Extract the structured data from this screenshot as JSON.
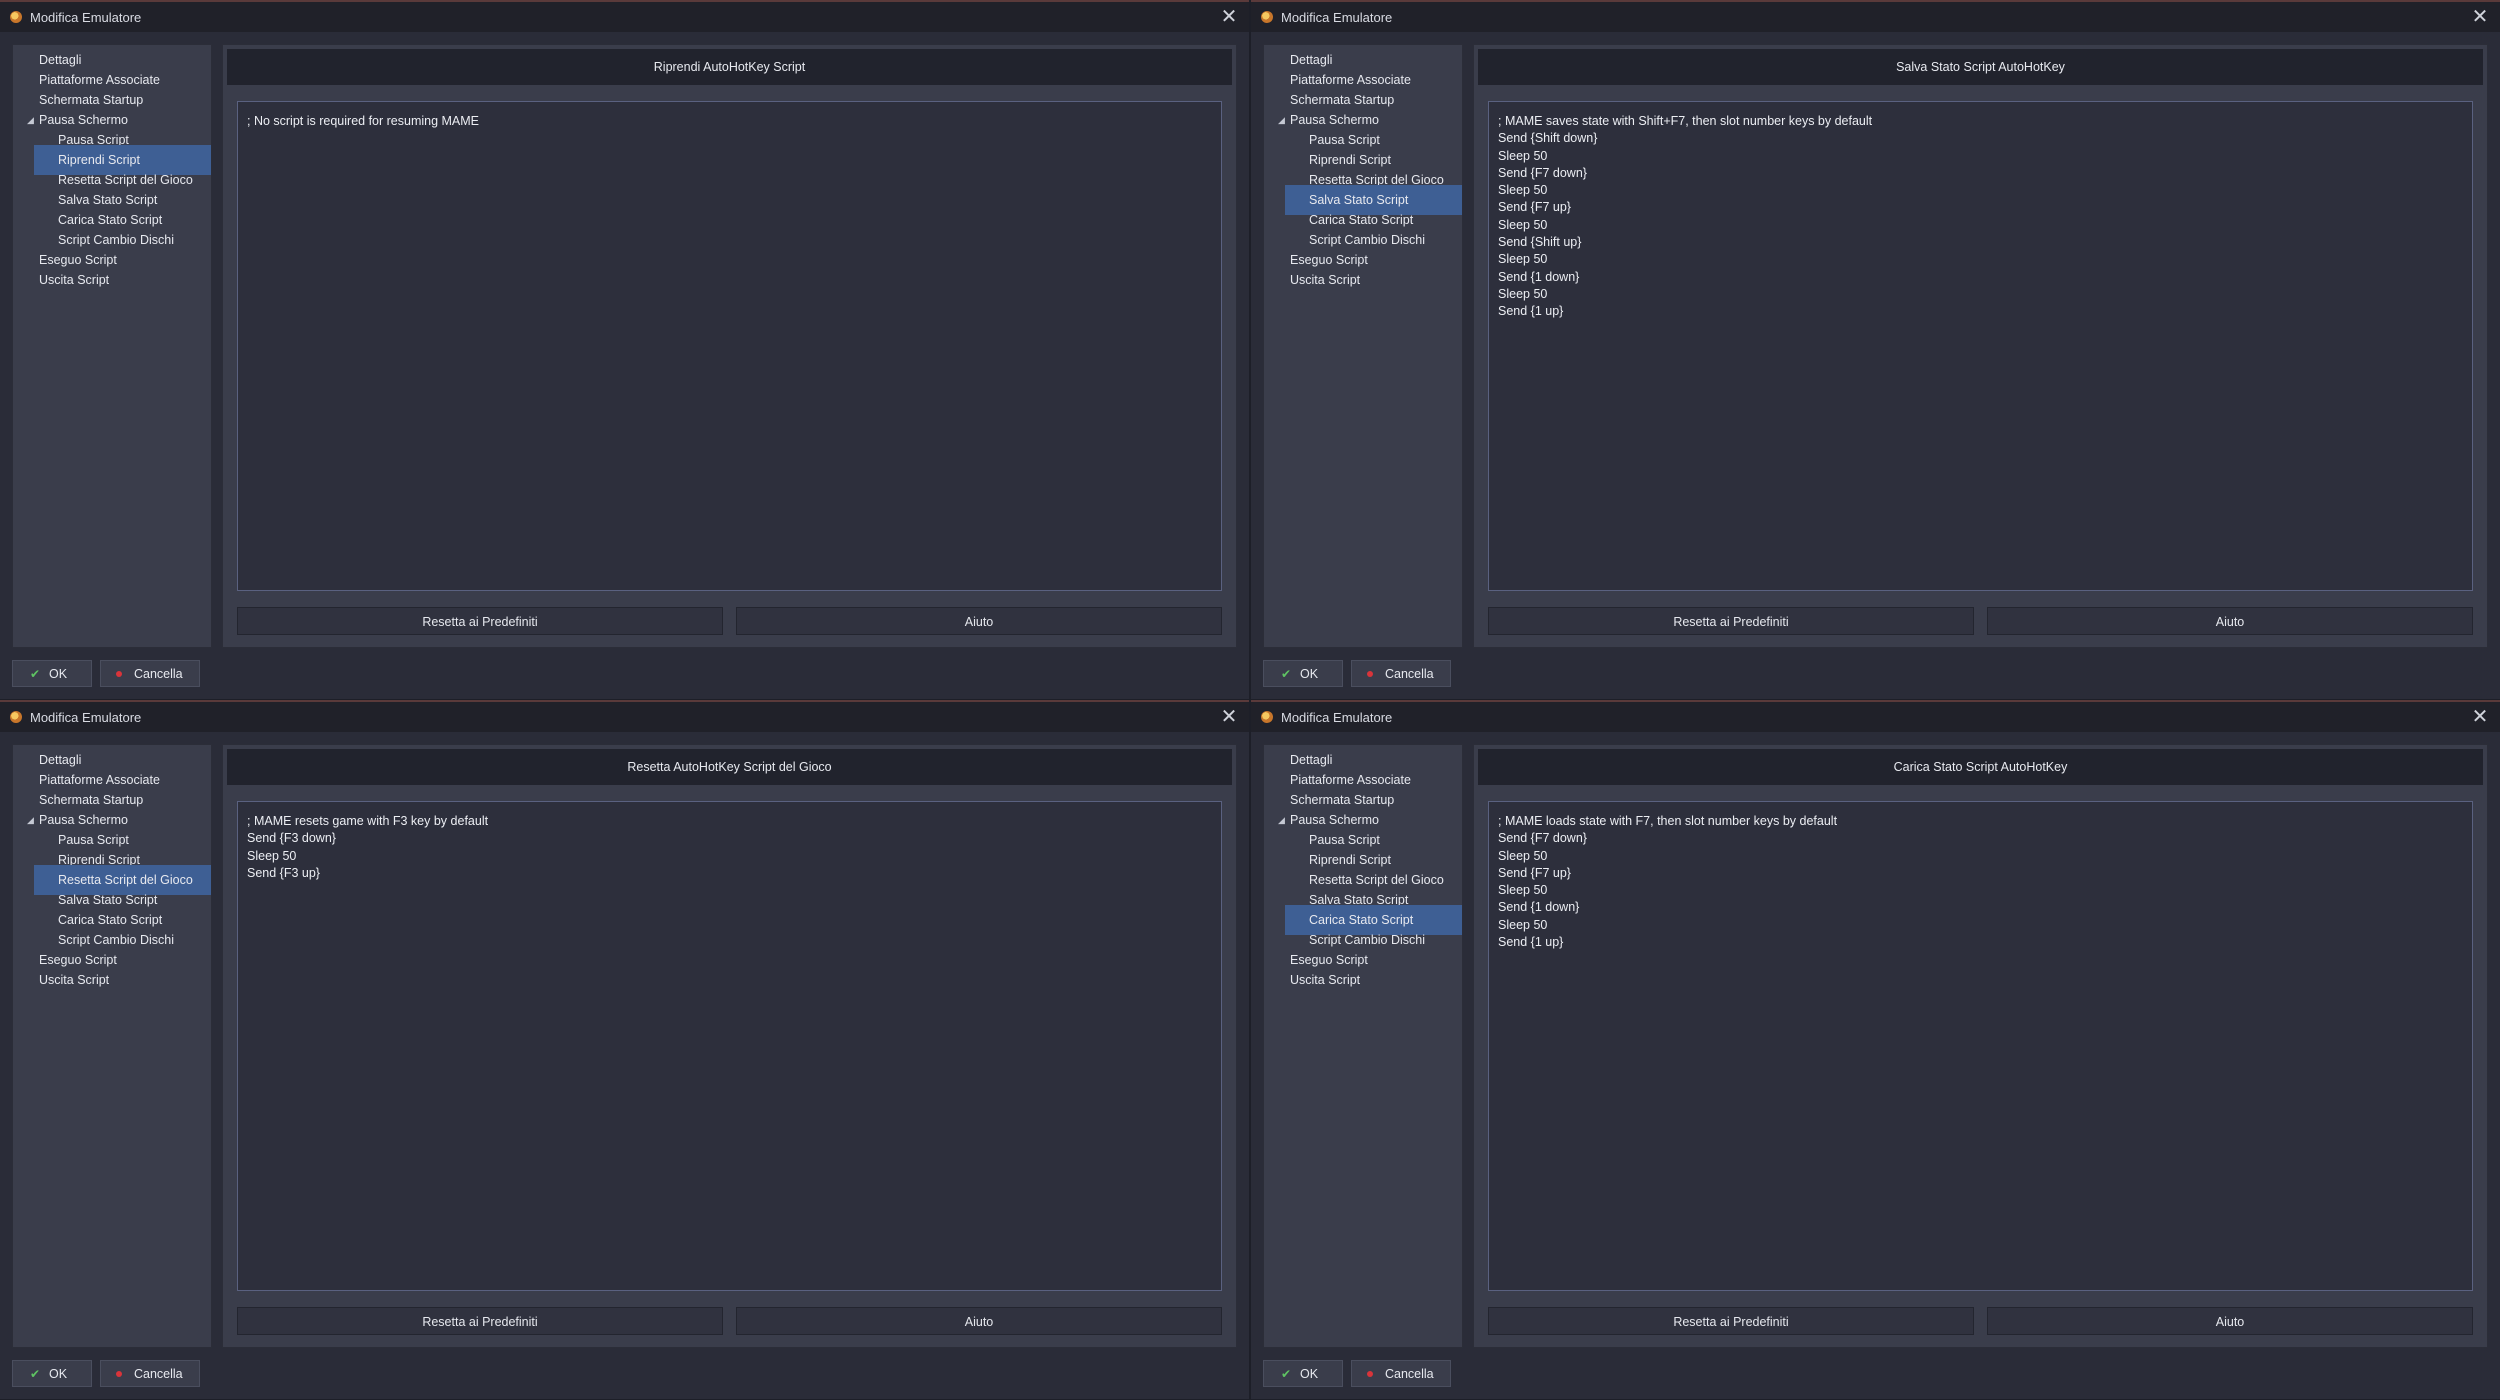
{
  "colors": {
    "accent_selected": "#3e5f94",
    "ok_check": "#5fc463",
    "cancel_dot": "#d9343a",
    "window_bg": "#2a2c38",
    "panel_bg": "#3a3d4b"
  },
  "windows": [
    {
      "title": "Modifica Emulatore",
      "nav": [
        {
          "label": "Dettagli"
        },
        {
          "label": "Piattaforme Associate"
        },
        {
          "label": "Schermata Startup"
        },
        {
          "label": "Pausa Schermo",
          "expanded": true
        },
        {
          "label": "Pausa Script"
        },
        {
          "label": "Riprendi Script",
          "selected": true
        },
        {
          "label": "Resetta Script del Gioco"
        },
        {
          "label": "Salva Stato Script"
        },
        {
          "label": "Carica Stato Script"
        },
        {
          "label": "Script Cambio Dischi"
        },
        {
          "label": "Eseguo Script"
        },
        {
          "label": "Uscita Script"
        }
      ],
      "header": "Riprendi AutoHotKey Script",
      "script": [
        "; No script is required for resuming MAME"
      ],
      "reset_label": "Resetta ai Predefiniti",
      "help_label": "Aiuto",
      "ok_label": "OK",
      "cancel_label": "Cancella"
    },
    {
      "title": "Modifica Emulatore",
      "nav": [
        {
          "label": "Dettagli"
        },
        {
          "label": "Piattaforme Associate"
        },
        {
          "label": "Schermata Startup"
        },
        {
          "label": "Pausa Schermo",
          "expanded": true
        },
        {
          "label": "Pausa Script"
        },
        {
          "label": "Riprendi Script"
        },
        {
          "label": "Resetta Script del Gioco"
        },
        {
          "label": "Salva Stato Script",
          "selected": true
        },
        {
          "label": "Carica Stato Script"
        },
        {
          "label": "Script Cambio Dischi"
        },
        {
          "label": "Eseguo Script"
        },
        {
          "label": "Uscita Script"
        }
      ],
      "header": "Salva Stato Script AutoHotKey",
      "script": [
        "; MAME saves state with Shift+F7, then slot number keys by default",
        "Send {Shift down}",
        "Sleep 50",
        "Send {F7 down}",
        "Sleep 50",
        "Send {F7 up}",
        "Sleep 50",
        "Send {Shift up}",
        "Sleep 50",
        "Send {1 down}",
        "Sleep 50",
        "Send {1 up}"
      ],
      "reset_label": "Resetta ai Predefiniti",
      "help_label": "Aiuto",
      "ok_label": "OK",
      "cancel_label": "Cancella"
    },
    {
      "title": "Modifica Emulatore",
      "nav": [
        {
          "label": "Dettagli"
        },
        {
          "label": "Piattaforme Associate"
        },
        {
          "label": "Schermata Startup"
        },
        {
          "label": "Pausa Schermo",
          "expanded": true
        },
        {
          "label": "Pausa Script"
        },
        {
          "label": "Riprendi Script"
        },
        {
          "label": "Resetta Script del Gioco",
          "selected": true
        },
        {
          "label": "Salva Stato Script"
        },
        {
          "label": "Carica Stato Script"
        },
        {
          "label": "Script Cambio Dischi"
        },
        {
          "label": "Eseguo Script"
        },
        {
          "label": "Uscita Script"
        }
      ],
      "header": "Resetta AutoHotKey Script del Gioco",
      "script": [
        "; MAME resets game with F3 key by default",
        "Send {F3 down}",
        "Sleep 50",
        "Send {F3 up}"
      ],
      "reset_label": "Resetta ai Predefiniti",
      "help_label": "Aiuto",
      "ok_label": "OK",
      "cancel_label": "Cancella"
    },
    {
      "title": "Modifica Emulatore",
      "nav": [
        {
          "label": "Dettagli"
        },
        {
          "label": "Piattaforme Associate"
        },
        {
          "label": "Schermata Startup"
        },
        {
          "label": "Pausa Schermo",
          "expanded": true
        },
        {
          "label": "Pausa Script"
        },
        {
          "label": "Riprendi Script"
        },
        {
          "label": "Resetta Script del Gioco"
        },
        {
          "label": "Salva Stato Script"
        },
        {
          "label": "Carica Stato Script",
          "selected": true
        },
        {
          "label": "Script Cambio Dischi"
        },
        {
          "label": "Eseguo Script"
        },
        {
          "label": "Uscita Script"
        }
      ],
      "header": "Carica Stato Script AutoHotKey",
      "script": [
        "; MAME loads state with F7, then slot number keys by default",
        "Send {F7 down}",
        "Sleep 50",
        "Send {F7 up}",
        "Sleep 50",
        "Send {1 down}",
        "Sleep 50",
        "Send {1 up}"
      ],
      "reset_label": "Resetta ai Predefiniti",
      "help_label": "Aiuto",
      "ok_label": "OK",
      "cancel_label": "Cancella"
    }
  ]
}
